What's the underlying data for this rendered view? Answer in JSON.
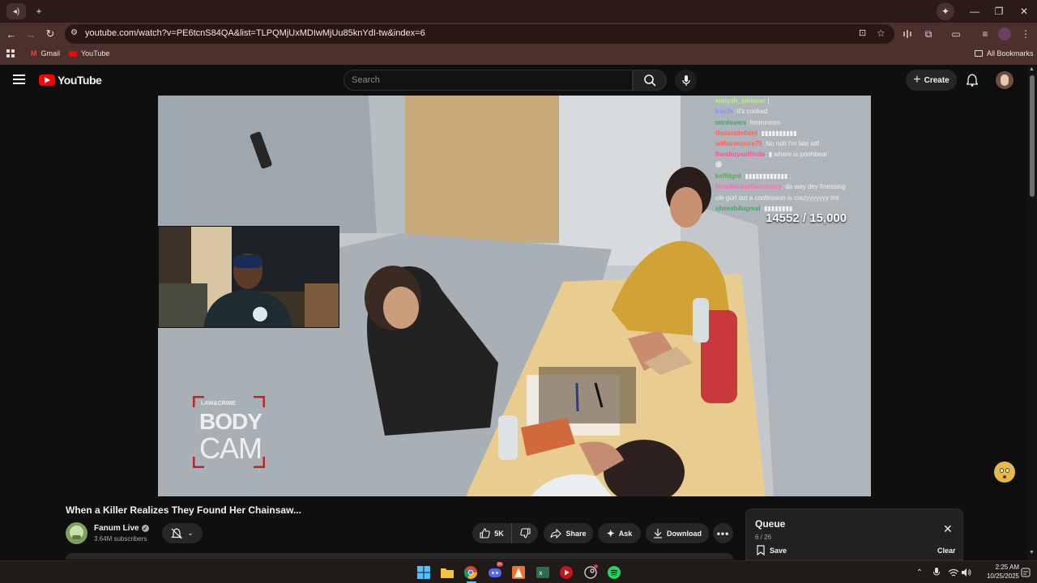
{
  "browser": {
    "new_tab_symbol": "+",
    "url": "youtube.com/watch?v=PE6tcnS84QA&list=TLPQMjUxMDIwMjUu85knYdI-tw&index=6",
    "bookmarks": [
      {
        "label": "Gmail",
        "icon": "gmail-icon"
      },
      {
        "label": "YouTube",
        "icon": "youtube-icon"
      }
    ],
    "all_bookmarks_label": "All Bookmarks"
  },
  "youtube": {
    "logo_text": "YouTube",
    "search_placeholder": "Search",
    "create_label": "Create"
  },
  "video": {
    "chat": [
      {
        "user": "amiyah_simone",
        "msg": ": |",
        "color": "#b9f27c"
      },
      {
        "user": "kay2k",
        "msg": ": it's cooked",
        "color": "#8e8cff"
      },
      {
        "user": "mtnlovers",
        "msg": ": hmmmmm",
        "color": "#3fa66b"
      },
      {
        "user": "thelastdefiant",
        "msg": ": ▮▮▮▮▮▮▮▮▮▮",
        "color": "#ff5f5f"
      },
      {
        "user": "willianmoore75",
        "msg": ": No noti I'm late wtf",
        "color": "#ff5f5f"
      },
      {
        "user": "flamboyantlinda",
        "msg": ": ▮ where is poohbear",
        "color": "#ff4f9a"
      },
      {
        "user": "",
        "msg": "",
        "color": "#ffffff"
      },
      {
        "user": "keffdgrd",
        "msg": ": ▮▮▮▮▮▮▮▮▮▮▮▮ ;",
        "color": "#4cae4c"
      },
      {
        "user": "RealAlexusSanctuary",
        "msg": ": da way dey finessing",
        "color": "#ff69b4"
      },
      {
        "user": "",
        "msg": "ole gurl out a confession is crazyyyyyyy lml",
        "color": "#ffffff"
      },
      {
        "user": "sheesh4ugmal",
        "msg": ": ▮▮▮▮▮▮▮▮",
        "color": "#3fa66b"
      }
    ],
    "counter": "14552 / 15,000",
    "overlay_logo": {
      "top": "LAW&CRIME",
      "mid": "BODY",
      "bottom": "CAM"
    }
  },
  "meta": {
    "title": "When a Killer Realizes They Found Her Chainsaw...",
    "channel": "Fanum Live",
    "subscribers": "3.64M subscribers",
    "likes": "5K",
    "share_label": "Share",
    "ask_label": "Ask",
    "download_label": "Download"
  },
  "queue": {
    "title": "Queue",
    "count": "6 / 26",
    "save_label": "Save",
    "clear_label": "Clear"
  },
  "taskbar": {
    "time": "2:25 AM",
    "date": "10/25/2025",
    "discord_badge": "9+"
  }
}
